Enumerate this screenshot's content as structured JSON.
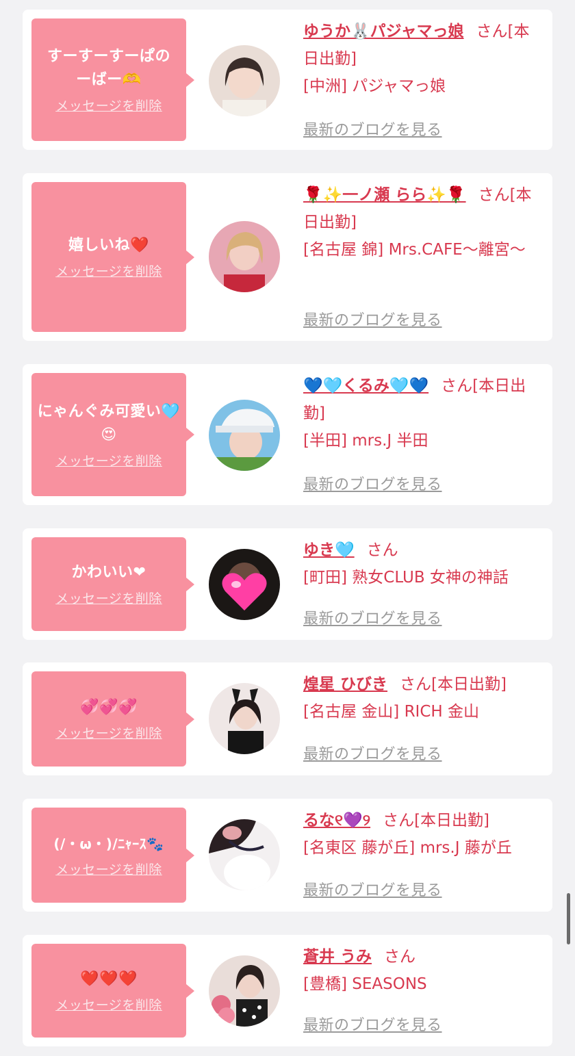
{
  "delete_label": "メッセージを削除",
  "blog_label": "最新のブログを見る",
  "san_label": "さん",
  "colors": {
    "accent": "#d8394f",
    "bubble": "#f8919f",
    "background": "#f2f2f4"
  },
  "cards": [
    {
      "message": "すーすーすーぱのーばー🫶",
      "name": "ゆうか🐰パジャマっ娘",
      "status": "[本日出勤]",
      "shop": "[中洲] パジャマっ娘",
      "avatar_icon": "girl-photo-avatar"
    },
    {
      "message": "嬉しいね❤️",
      "name": "🌹✨一ノ瀬 らら✨🌹",
      "status": "[本日出勤]",
      "shop": "[名古屋 錦] Mrs.CAFE～離宮～",
      "avatar_icon": "girl-photo-avatar"
    },
    {
      "message": "にゃんぐみ可愛い🩵😍",
      "name": "💙🩵くるみ🩵💙",
      "status": "[本日出勤]",
      "shop": "[半田] mrs.J 半田",
      "avatar_icon": "girl-photo-avatar"
    },
    {
      "message": "かわいい❤",
      "name": "ゆき🩵",
      "status": "",
      "shop": "[町田] 熟女CLUB 女神の神話",
      "avatar_icon": "heart-sticker-avatar"
    },
    {
      "message": "💞💞💞",
      "name": "煌星 ひびき",
      "status": "[本日出勤]",
      "shop": "[名古屋 金山] RICH 金山",
      "avatar_icon": "bunny-girl-avatar"
    },
    {
      "message": "(/・ω・)/ﾆｬｰｽ🐾",
      "name": "るな୧💜୨",
      "status": "[本日出勤]",
      "shop": "[名東区 藤が丘] mrs.J 藤が丘",
      "avatar_icon": "girl-photo-avatar"
    },
    {
      "message": "❤️❤️❤️",
      "name": "蒼井 うみ",
      "status": "",
      "shop": "[豊橋] SEASONS",
      "avatar_icon": "girl-photo-avatar"
    }
  ]
}
